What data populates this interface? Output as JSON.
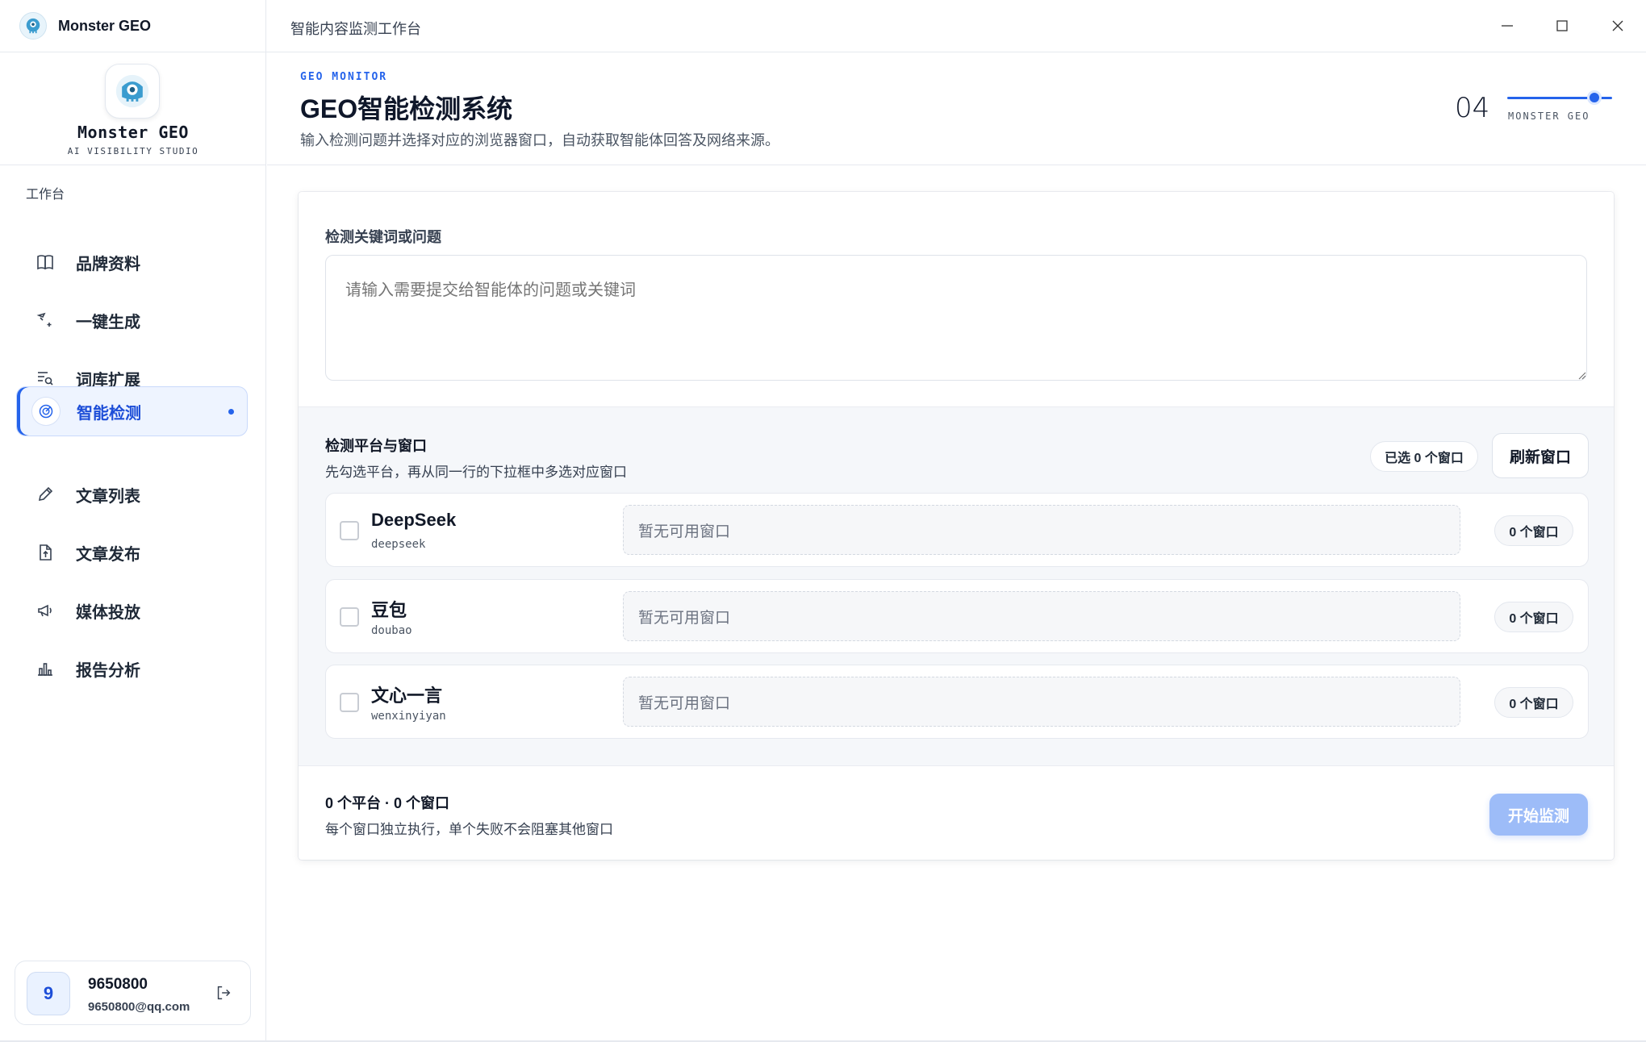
{
  "app": {
    "name": "Monster GEO",
    "window_title": "智能内容监测工作台"
  },
  "brand": {
    "title": "Monster GEO",
    "subtitle": "AI VISIBILITY STUDIO"
  },
  "sidebar": {
    "section": "工作台",
    "items": [
      {
        "label": "品牌资料",
        "icon": "book-icon"
      },
      {
        "label": "一键生成",
        "icon": "magic-wand-icon"
      },
      {
        "label": "词库扩展",
        "icon": "list-search-icon"
      },
      {
        "label": "智能检测",
        "icon": "target-icon",
        "active": true
      },
      {
        "label": "文章列表",
        "icon": "pencil-icon"
      },
      {
        "label": "文章发布",
        "icon": "file-upload-icon"
      },
      {
        "label": "媒体投放",
        "icon": "megaphone-icon"
      },
      {
        "label": "报告分析",
        "icon": "bar-chart-icon"
      }
    ]
  },
  "user": {
    "avatar": "9",
    "name": "9650800",
    "email": "9650800@qq.com"
  },
  "header": {
    "eyebrow": "GEO MONITOR",
    "title": "GEO智能检测系统",
    "description": "输入检测问题并选择对应的浏览器窗口，自动获取智能体回答及网络来源。",
    "step": "04",
    "step_label": "MONSTER GEO"
  },
  "query": {
    "label": "检测关键词或问题",
    "placeholder": "请输入需要提交给智能体的问题或关键词",
    "value": ""
  },
  "platforms": {
    "title": "检测平台与窗口",
    "description": "先勾选平台，再从同一行的下拉框中多选对应窗口",
    "selected_pill": "已选 0 个窗口",
    "refresh_label": "刷新窗口",
    "rows": [
      {
        "name": "DeepSeek",
        "code": "deepseek",
        "select_placeholder": "暂无可用窗口",
        "count": "0 个窗口",
        "checked": false
      },
      {
        "name": "豆包",
        "code": "doubao",
        "select_placeholder": "暂无可用窗口",
        "count": "0 个窗口",
        "checked": false
      },
      {
        "name": "文心一言",
        "code": "wenxinyiyan",
        "select_placeholder": "暂无可用窗口",
        "count": "0 个窗口",
        "checked": false
      }
    ]
  },
  "summary": {
    "title": "0 个平台 · 0 个窗口",
    "description": "每个窗口独立执行，单个失败不会阻塞其他窗口",
    "start_label": "开始监测"
  },
  "colors": {
    "accent": "#2563eb",
    "accent_soft": "#eef4ff",
    "start_disabled": "#9dbcf8"
  }
}
